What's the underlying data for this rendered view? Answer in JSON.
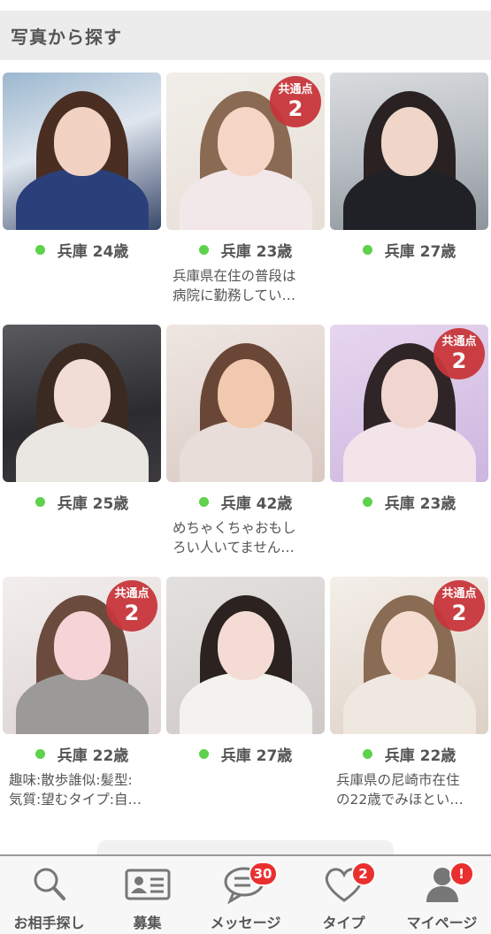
{
  "header": {
    "title": "写真から探す"
  },
  "profiles": [
    {
      "location": "兵庫",
      "age": "24歳",
      "description": "",
      "common_points": null
    },
    {
      "location": "兵庫",
      "age": "23歳",
      "description": "兵庫県在住の普段は\n病院に勤務してい…",
      "common_points": {
        "label": "共通点",
        "count": "2"
      }
    },
    {
      "location": "兵庫",
      "age": "27歳",
      "description": "",
      "common_points": null
    },
    {
      "location": "兵庫",
      "age": "25歳",
      "description": "",
      "common_points": null
    },
    {
      "location": "兵庫",
      "age": "42歳",
      "description": "めちゃくちゃおもし\nろい人いてません…",
      "common_points": null
    },
    {
      "location": "兵庫",
      "age": "23歳",
      "description": "",
      "common_points": {
        "label": "共通点",
        "count": "2"
      }
    },
    {
      "location": "兵庫",
      "age": "22歳",
      "description": "趣味:散歩誰似:髪型:\n気質:望むタイプ:自…",
      "common_points": {
        "label": "共通点",
        "count": "2"
      }
    },
    {
      "location": "兵庫",
      "age": "27歳",
      "description": "",
      "common_points": null
    },
    {
      "location": "兵庫",
      "age": "22歳",
      "description": "兵庫県の尼崎市在住\nの22歳でみほとい…",
      "common_points": {
        "label": "共通点",
        "count": "2"
      }
    }
  ],
  "tabs": [
    {
      "label": "お相手探し",
      "icon": "search-icon",
      "badge": ""
    },
    {
      "label": "募集",
      "icon": "id-card-icon",
      "badge": ""
    },
    {
      "label": "メッセージ",
      "icon": "chat-bubbles-icon",
      "badge": "30"
    },
    {
      "label": "タイプ",
      "icon": "heart-icon",
      "badge": "2"
    },
    {
      "label": "マイページ",
      "icon": "person-icon",
      "badge": "!"
    }
  ],
  "colors": {
    "online": "#5dd24a",
    "badge": "#c8363b",
    "notification": "#e9302f"
  }
}
